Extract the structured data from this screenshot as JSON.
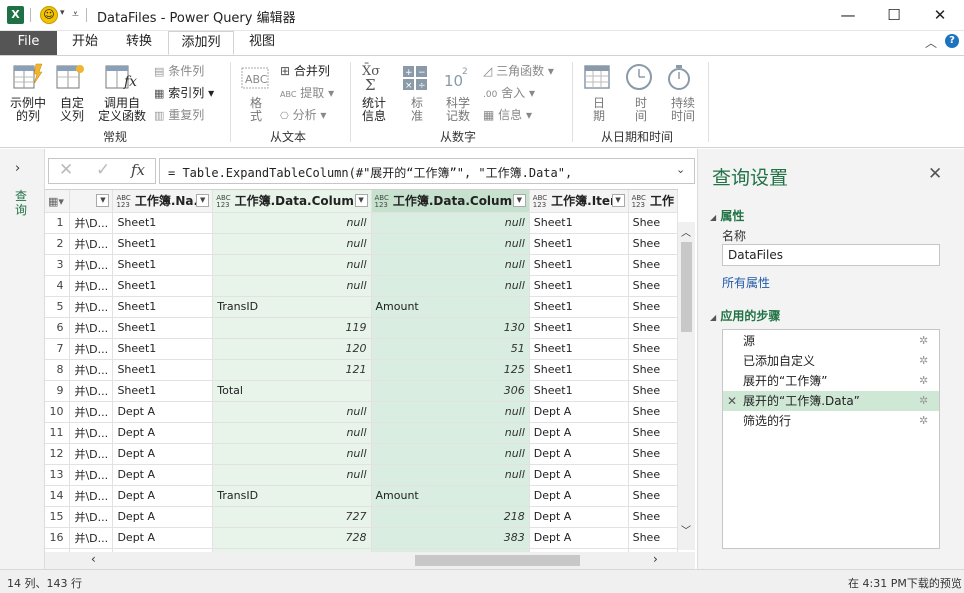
{
  "window": {
    "title": "DataFiles - Power Query 编辑器",
    "app_icon": "X",
    "controls": {
      "minimize": "—",
      "maximize": "☐",
      "close": "✕"
    }
  },
  "tabs": [
    {
      "label": "File"
    },
    {
      "label": "开始"
    },
    {
      "label": "转换"
    },
    {
      "label": "添加列",
      "active": true
    },
    {
      "label": "视图"
    }
  ],
  "ribbon": {
    "general": {
      "group_label": "常规",
      "example_col": "示例中\n的列",
      "custom_col": "自定\n义列",
      "invoke_fn": "调用自\n定义函数",
      "cond_col": "条件列",
      "index_col": "索引列",
      "dup_col": "重复列"
    },
    "text": {
      "group_label": "从文本",
      "format": "格\n式",
      "merge": "合并列",
      "extract": "提取",
      "parse": "分析"
    },
    "number": {
      "group_label": "从数字",
      "stats": "统计\n信息",
      "standard": "标\n准",
      "scientific": "科学\n记数",
      "trig": "三角函数",
      "rounding": "舍入",
      "info": "信息"
    },
    "datetime": {
      "group_label": "从日期和时间",
      "date": "日\n期",
      "time": "时\n间",
      "duration": "持续\n时间"
    }
  },
  "left_pane": {
    "label": "查询"
  },
  "formula": "= Table.ExpandTableColumn(#\"展开的“工作簿”\", \"工作簿.Data\",",
  "columns": [
    {
      "type": "",
      "name": ""
    },
    {
      "type": "ABC\n123",
      "name": "工作簿.Na..."
    },
    {
      "type": "ABC\n123",
      "name": "工作簿.Data.Colum..."
    },
    {
      "type": "ABC\n123",
      "name": "工作簿.Data.Colum..."
    },
    {
      "type": "ABC\n123",
      "name": "工作簿.Item"
    },
    {
      "type": "ABC\n123",
      "name": "工作"
    }
  ],
  "rows": [
    {
      "n": "1",
      "a": "并\\D...",
      "b": "Sheet1",
      "c": "null",
      "d": "null",
      "e": "Sheet1",
      "f": "Shee"
    },
    {
      "n": "2",
      "a": "并\\D...",
      "b": "Sheet1",
      "c": "null",
      "d": "null",
      "e": "Sheet1",
      "f": "Shee"
    },
    {
      "n": "3",
      "a": "并\\D...",
      "b": "Sheet1",
      "c": "null",
      "d": "null",
      "e": "Sheet1",
      "f": "Shee"
    },
    {
      "n": "4",
      "a": "并\\D...",
      "b": "Sheet1",
      "c": "null",
      "d": "null",
      "e": "Sheet1",
      "f": "Shee"
    },
    {
      "n": "5",
      "a": "并\\D...",
      "b": "Sheet1",
      "c": "TransID",
      "d": "Amount",
      "e": "Sheet1",
      "f": "Shee"
    },
    {
      "n": "6",
      "a": "并\\D...",
      "b": "Sheet1",
      "c": "119",
      "d": "130",
      "e": "Sheet1",
      "f": "Shee"
    },
    {
      "n": "7",
      "a": "并\\D...",
      "b": "Sheet1",
      "c": "120",
      "d": "51",
      "e": "Sheet1",
      "f": "Shee"
    },
    {
      "n": "8",
      "a": "并\\D...",
      "b": "Sheet1",
      "c": "121",
      "d": "125",
      "e": "Sheet1",
      "f": "Shee"
    },
    {
      "n": "9",
      "a": "并\\D...",
      "b": "Sheet1",
      "c": "Total",
      "d": "306",
      "e": "Sheet1",
      "f": "Shee"
    },
    {
      "n": "10",
      "a": "并\\D...",
      "b": "Dept A",
      "c": "null",
      "d": "null",
      "e": "Dept A",
      "f": "Shee"
    },
    {
      "n": "11",
      "a": "并\\D...",
      "b": "Dept A",
      "c": "null",
      "d": "null",
      "e": "Dept A",
      "f": "Shee"
    },
    {
      "n": "12",
      "a": "并\\D...",
      "b": "Dept A",
      "c": "null",
      "d": "null",
      "e": "Dept A",
      "f": "Shee"
    },
    {
      "n": "13",
      "a": "并\\D...",
      "b": "Dept A",
      "c": "null",
      "d": "null",
      "e": "Dept A",
      "f": "Shee"
    },
    {
      "n": "14",
      "a": "并\\D...",
      "b": "Dept A",
      "c": "TransID",
      "d": "Amount",
      "e": "Dept A",
      "f": "Shee"
    },
    {
      "n": "15",
      "a": "并\\D...",
      "b": "Dept A",
      "c": "727",
      "d": "218",
      "e": "Dept A",
      "f": "Shee"
    },
    {
      "n": "16",
      "a": "并\\D...",
      "b": "Dept A",
      "c": "728",
      "d": "383",
      "e": "Dept A",
      "f": "Shee"
    },
    {
      "n": "17",
      "a": "",
      "b": "",
      "c": "",
      "d": "",
      "e": "",
      "f": ""
    }
  ],
  "query_settings": {
    "title": "查询设置",
    "props_header": "属性",
    "name_label": "名称",
    "name_value": "DataFiles",
    "all_props": "所有属性",
    "steps_header": "应用的步骤",
    "steps": [
      {
        "label": "源",
        "selected": false
      },
      {
        "label": "已添加自定义",
        "selected": false
      },
      {
        "label": "展开的“工作簿”",
        "selected": false
      },
      {
        "label": "展开的“工作簿.Data”",
        "selected": true
      },
      {
        "label": "筛选的行",
        "selected": false
      }
    ]
  },
  "status": {
    "left": "14 列、143 行",
    "right": "在 4:31 PM下载的预览"
  },
  "colors": {
    "excel_green": "#217346",
    "selected_step": "#cfe8d6",
    "column_highlight": "#d9ede0"
  }
}
